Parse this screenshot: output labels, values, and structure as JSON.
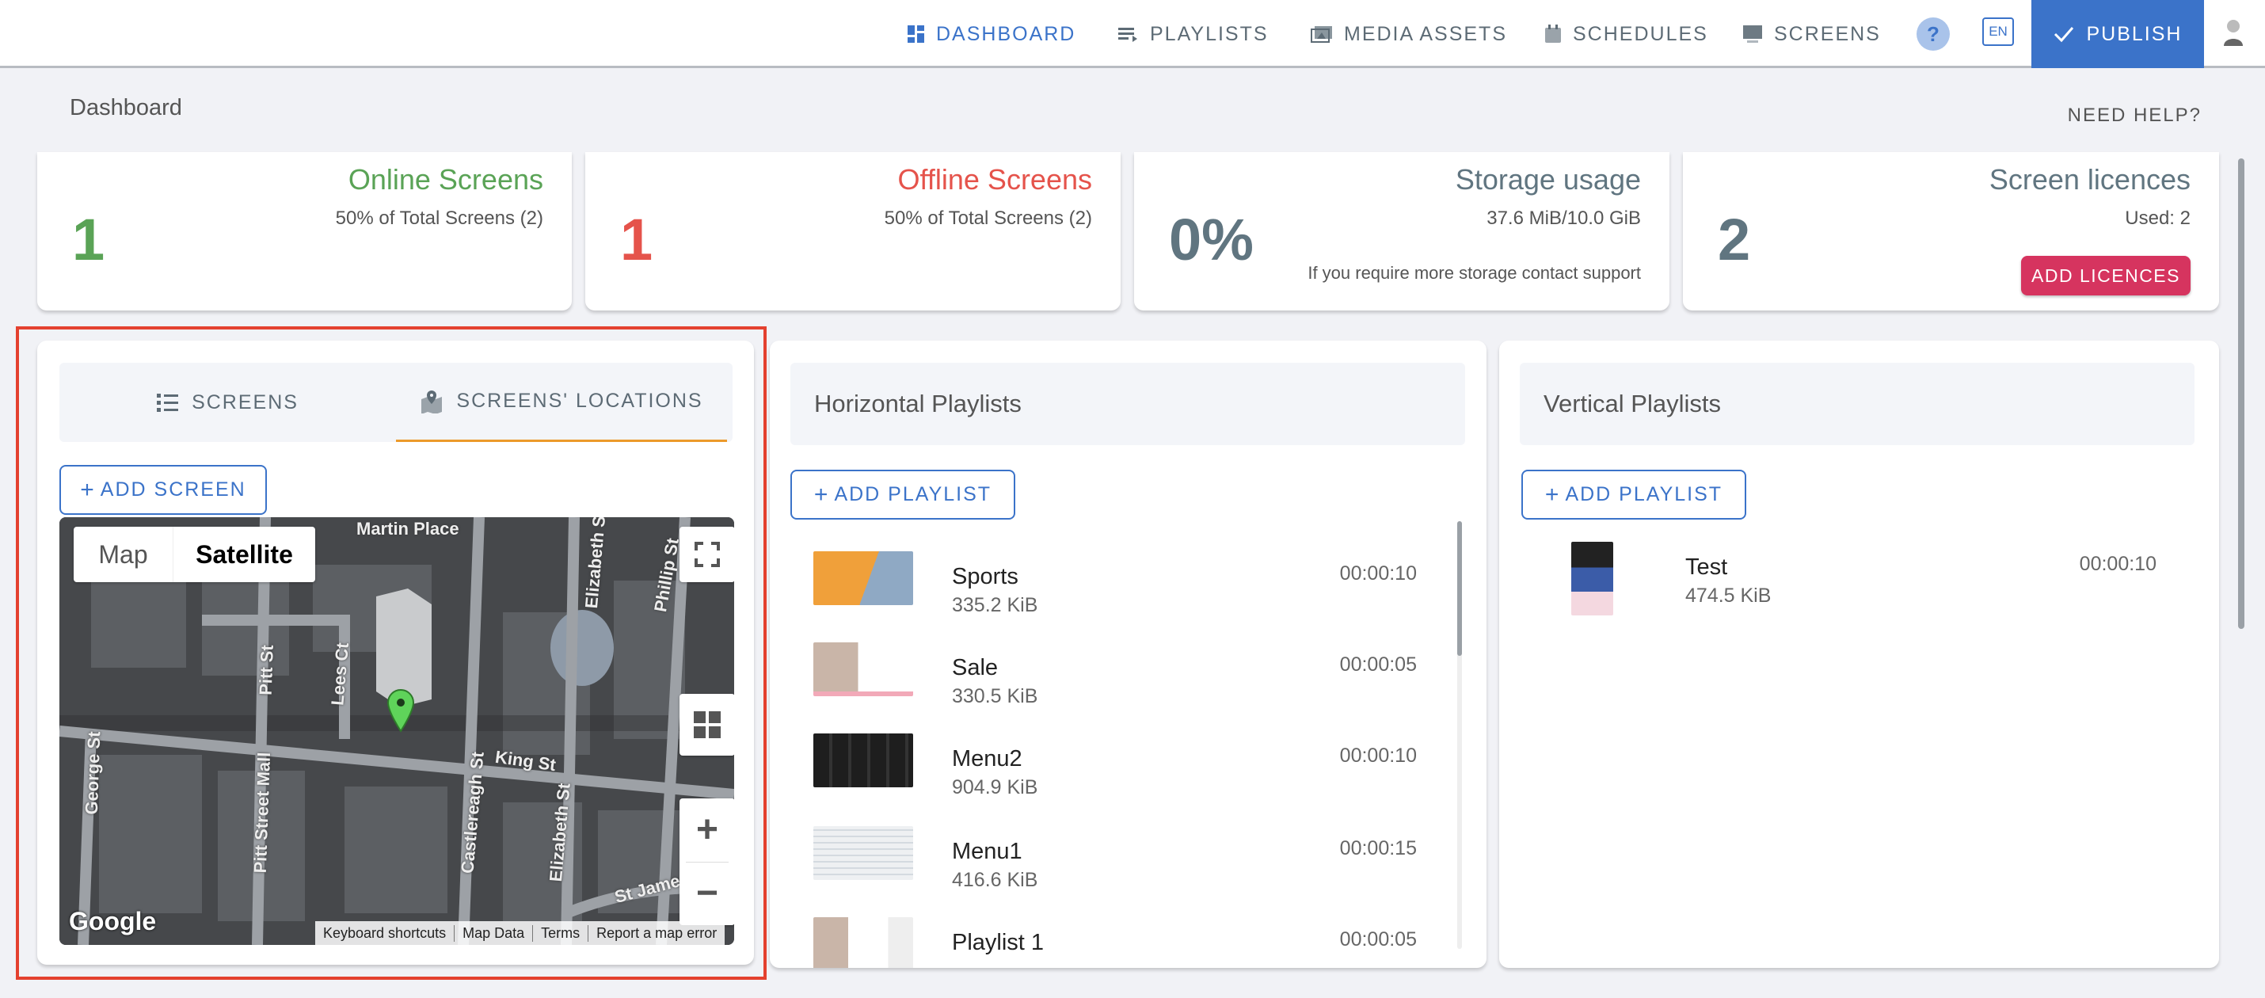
{
  "nav": {
    "items": [
      {
        "label": "DASHBOARD",
        "icon": "dashboard-icon",
        "active": true
      },
      {
        "label": "PLAYLISTS",
        "icon": "playlist-icon"
      },
      {
        "label": "MEDIA ASSETS",
        "icon": "media-icon"
      },
      {
        "label": "SCHEDULES",
        "icon": "calendar-icon"
      },
      {
        "label": "SCREENS",
        "icon": "monitor-icon"
      }
    ],
    "help": "?",
    "lang": "EN",
    "publish": "PUBLISH"
  },
  "page": {
    "title": "Dashboard",
    "help_link": "NEED HELP?"
  },
  "stats": [
    {
      "title": "Online Screens",
      "value": "1",
      "sub": "50% of Total Screens (2)",
      "color": "#5aa356"
    },
    {
      "title": "Offline Screens",
      "value": "1",
      "sub": "50% of Total Screens (2)",
      "color": "#e5534b"
    },
    {
      "title": "Storage usage",
      "value": "0%",
      "sub": "37.6 MiB/10.0 GiB",
      "note": "If you require more storage contact support"
    },
    {
      "title": "Screen licences",
      "value": "2",
      "sub": "Used: 2",
      "button": "ADD LICENCES"
    }
  ],
  "screens_panel": {
    "tabs": [
      "SCREENS",
      "SCREENS' LOCATIONS"
    ],
    "active_tab": 1,
    "add_button": "ADD SCREEN",
    "map": {
      "types": [
        "Map",
        "Satellite"
      ],
      "active_type": "Satellite",
      "streets": [
        "Martin Place",
        "Elizabeth St",
        "Phillip St",
        "Pitt St",
        "Lees Ct",
        "George St",
        "Pitt Street Mall",
        "King St",
        "Castlereagh St",
        "Elizabeth St",
        "St James"
      ],
      "logo": "Google",
      "footer": [
        "Keyboard shortcuts",
        "Map Data",
        "Terms",
        "Report a map error"
      ],
      "zoom_in": "+",
      "zoom_out": "−"
    }
  },
  "horizontal": {
    "title": "Horizontal Playlists",
    "add_button": "ADD PLAYLIST",
    "items": [
      {
        "name": "Sports",
        "size": "335.2 KiB",
        "duration": "00:00:10"
      },
      {
        "name": "Sale",
        "size": "330.5 KiB",
        "duration": "00:00:05"
      },
      {
        "name": "Menu2",
        "size": "904.9 KiB",
        "duration": "00:00:10"
      },
      {
        "name": "Menu1",
        "size": "416.6 KiB",
        "duration": "00:00:15"
      },
      {
        "name": "Playlist 1",
        "size": "",
        "duration": "00:00:05"
      }
    ]
  },
  "vertical": {
    "title": "Vertical Playlists",
    "add_button": "ADD PLAYLIST",
    "items": [
      {
        "name": "Test",
        "size": "474.5 KiB",
        "duration": "00:00:10"
      }
    ]
  }
}
